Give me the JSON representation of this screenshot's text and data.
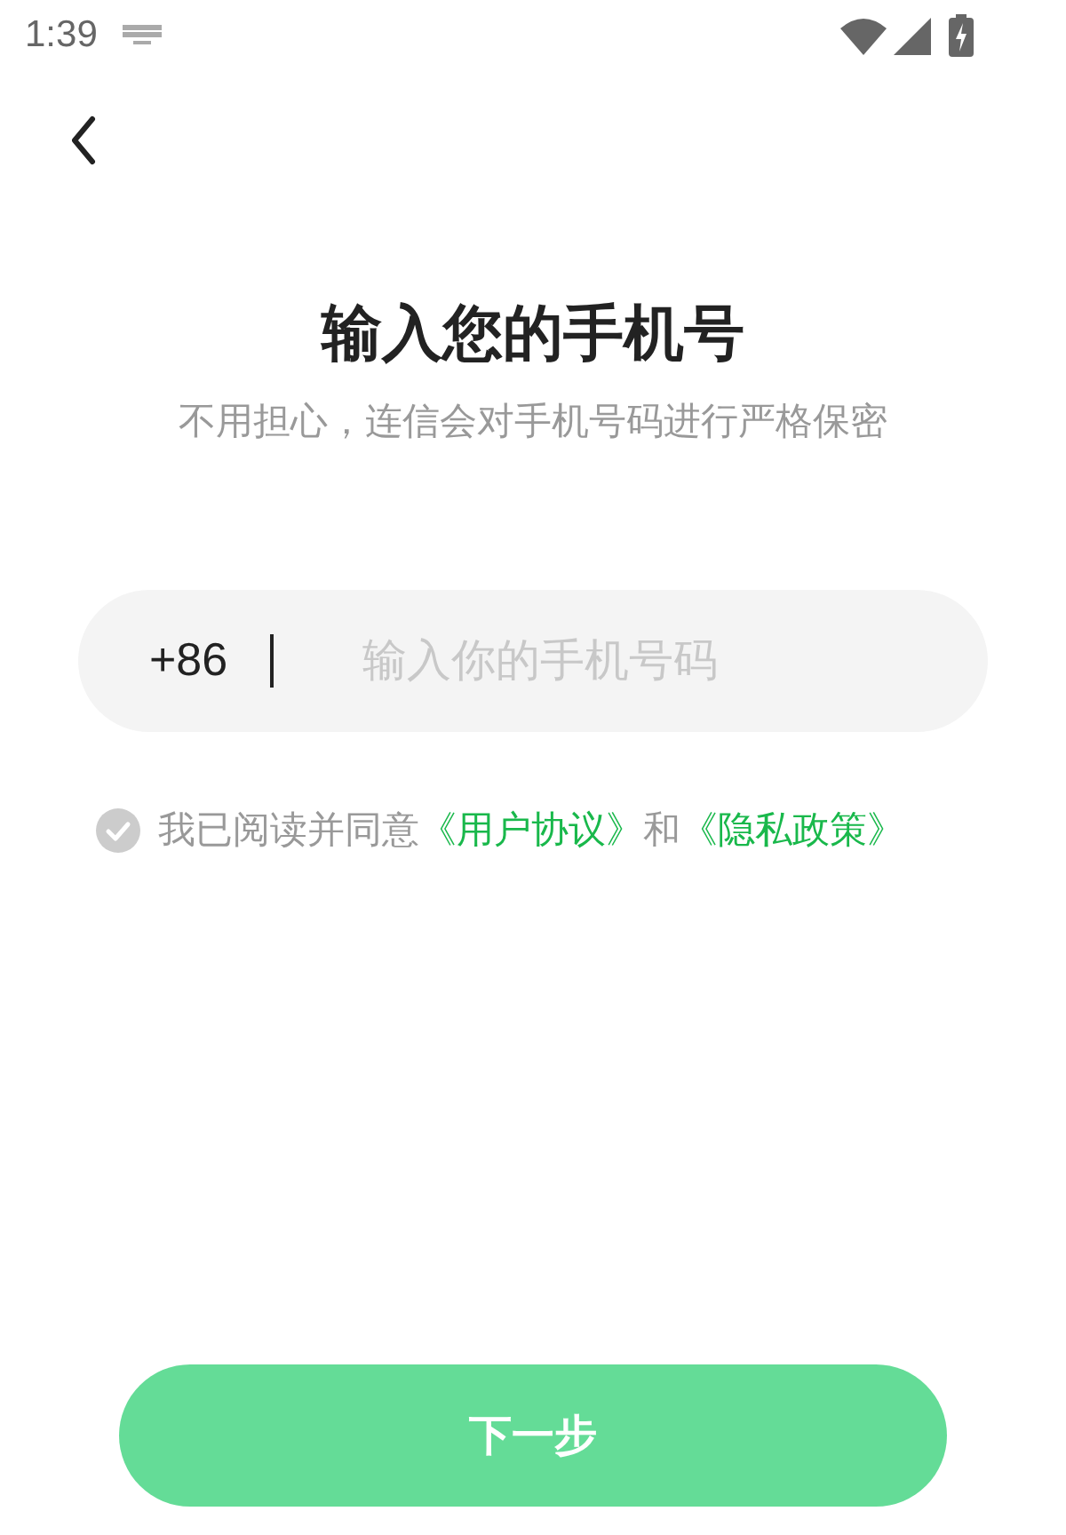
{
  "status_bar": {
    "time": "1:39"
  },
  "title": "输入您的手机号",
  "subtitle": "不用担心，连信会对手机号码进行严格保密",
  "phone": {
    "country_code": "+86",
    "placeholder": "输入你的手机号码"
  },
  "agreement": {
    "checked": false,
    "parts": [
      {
        "kind": "text",
        "text": "我已阅读并同意"
      },
      {
        "kind": "link",
        "text": "《用户协议》"
      },
      {
        "kind": "text",
        "text": "和"
      },
      {
        "kind": "link",
        "text": "《隐私政策》"
      }
    ]
  },
  "next_button": {
    "label": "下一步",
    "disabled": true
  }
}
